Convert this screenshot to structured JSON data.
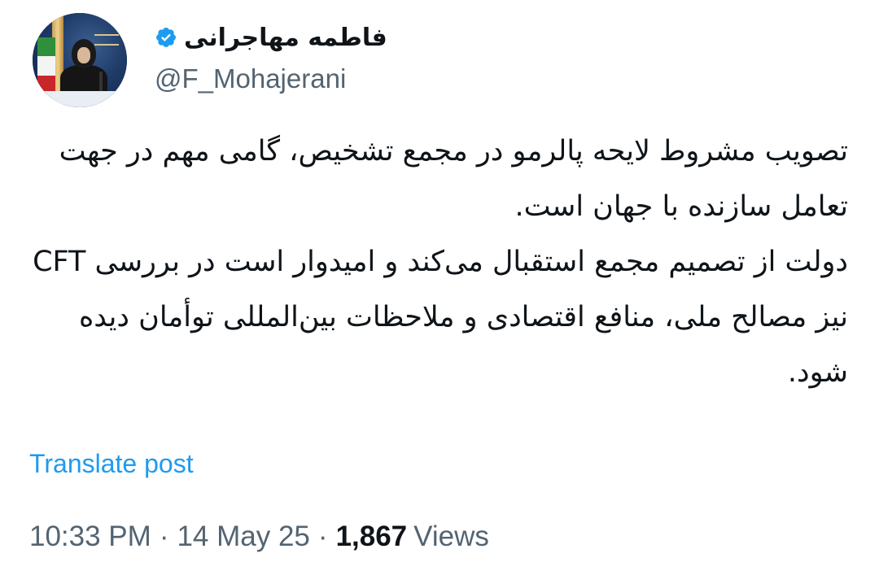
{
  "author": {
    "display_name": "فاطمه مهاجرانی",
    "handle": "@F_Mohajerani",
    "verified": true,
    "verified_badge_color": "#1d9bf0",
    "avatar_icon": "profile-photo"
  },
  "post": {
    "paragraph_1": "تصویب مشروط لایحه پالرمو در مجمع تشخیص، گامی مهم در جهت تعامل سازنده با جهان است.",
    "paragraph_2": "دولت از تصمیم مجمع استقبال می‌کند و امیدوار است در بررسی CFT نیز مصالح ملی، منافع اقتصادی و ملاحظات بین‌المللی توأمان دیده شود."
  },
  "actions": {
    "translate_label": "Translate post",
    "link_color": "#1d9bf0"
  },
  "meta": {
    "time": "10:33 PM",
    "separator": "·",
    "date": "14 May 25",
    "views_count": "1,867",
    "views_label": "Views"
  }
}
